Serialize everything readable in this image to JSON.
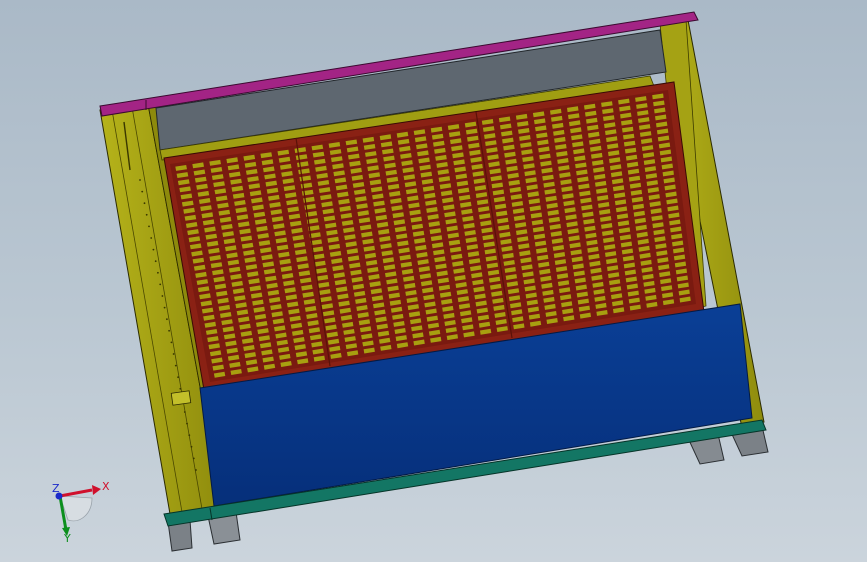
{
  "viewport": {
    "colors": {
      "frame": "#9e9c12",
      "frame_dark": "#6d6a08",
      "top_rail": "#a01f82",
      "top_panel": "#5f6870",
      "grille_border": "#8c2216",
      "grille_slat": "#a8a010",
      "blue_panel": "#08378a",
      "base_rail": "#127563",
      "feet": "#7f858b"
    },
    "grille": {
      "columns": 29,
      "rows": 30
    }
  },
  "triad": {
    "x_label": "X",
    "y_label": "Y",
    "z_label": "Z",
    "x_color": "#d0102c",
    "y_color": "#0c8f1d",
    "z_color": "#1b2ac9"
  }
}
